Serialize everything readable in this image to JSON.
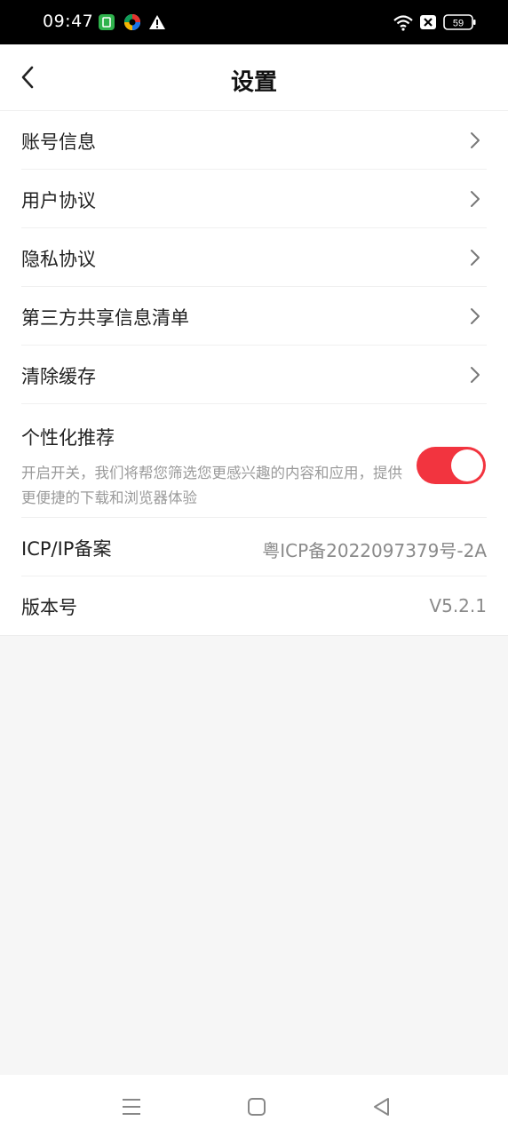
{
  "status_bar": {
    "time": "09:47",
    "battery": "59",
    "icons": [
      "app-green-icon",
      "app-colorful-icon",
      "warning-icon",
      "wifi-icon",
      "no-sim-icon",
      "battery-icon"
    ]
  },
  "header": {
    "title": "设置",
    "back_icon": "chevron-left-icon"
  },
  "settings": {
    "items": [
      {
        "label": "账号信息"
      },
      {
        "label": "用户协议"
      },
      {
        "label": "隐私协议"
      },
      {
        "label": "第三方共享信息清单"
      },
      {
        "label": "清除缓存"
      }
    ],
    "personalized": {
      "label": "个性化推荐",
      "description": "开启开关，我们将帮您筛选您更感兴趣的内容和应用，提供更便捷的下载和浏览器体验",
      "enabled": true,
      "toggle_color": "#f2343f"
    },
    "icp": {
      "label": "ICP/IP备案",
      "value": "粤ICP备2022097379号-2A"
    },
    "version": {
      "label": "版本号",
      "value": "V5.2.1"
    }
  },
  "nav_bar": {
    "icons": [
      "menu-icon",
      "home-icon",
      "back-icon"
    ]
  }
}
